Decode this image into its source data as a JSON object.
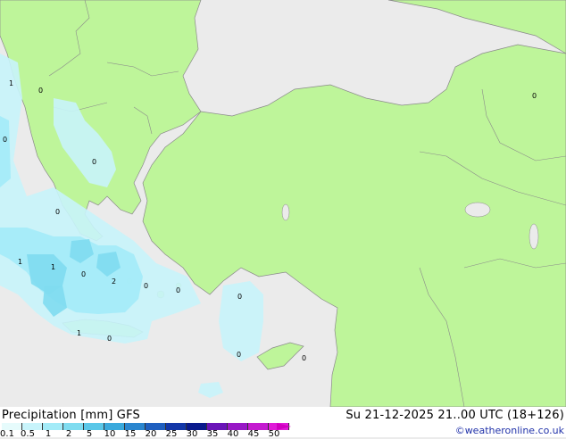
{
  "footer": {
    "title_left": "Precipitation [mm] GFS",
    "title_right": "Su 21-12-2025 21..00 UTC (18+126)",
    "credit": "©weatheronline.co.uk"
  },
  "legend": {
    "ticks": [
      "0.1",
      "0.5",
      "1",
      "2",
      "5",
      "10",
      "15",
      "20",
      "25",
      "30",
      "35",
      "40",
      "45",
      "50"
    ],
    "colors": [
      "#e6fbfc",
      "#c8f4fb",
      "#a3ebf8",
      "#7fdcf0",
      "#5ac7e8",
      "#3aa9dc",
      "#2a86cf",
      "#1f5fbf",
      "#1337a8",
      "#0a1a8c",
      "#6a14b8",
      "#9818c6",
      "#c41ad0",
      "#e01bd8"
    ]
  },
  "map": {
    "land_color": "#bef59a",
    "sea_color": "#ebebeb",
    "border_color": "#8a8a8a",
    "precip_light_color": "#c8f4fb",
    "precip_mid_color": "#a3ebf8",
    "precip_heavy_color": "#7fdcf0",
    "labels": [
      "1",
      "0",
      "0",
      "0",
      "0",
      "1",
      "1",
      "0",
      "2",
      "0",
      "0",
      "0",
      "1",
      "0",
      "0",
      "0",
      "0"
    ]
  }
}
